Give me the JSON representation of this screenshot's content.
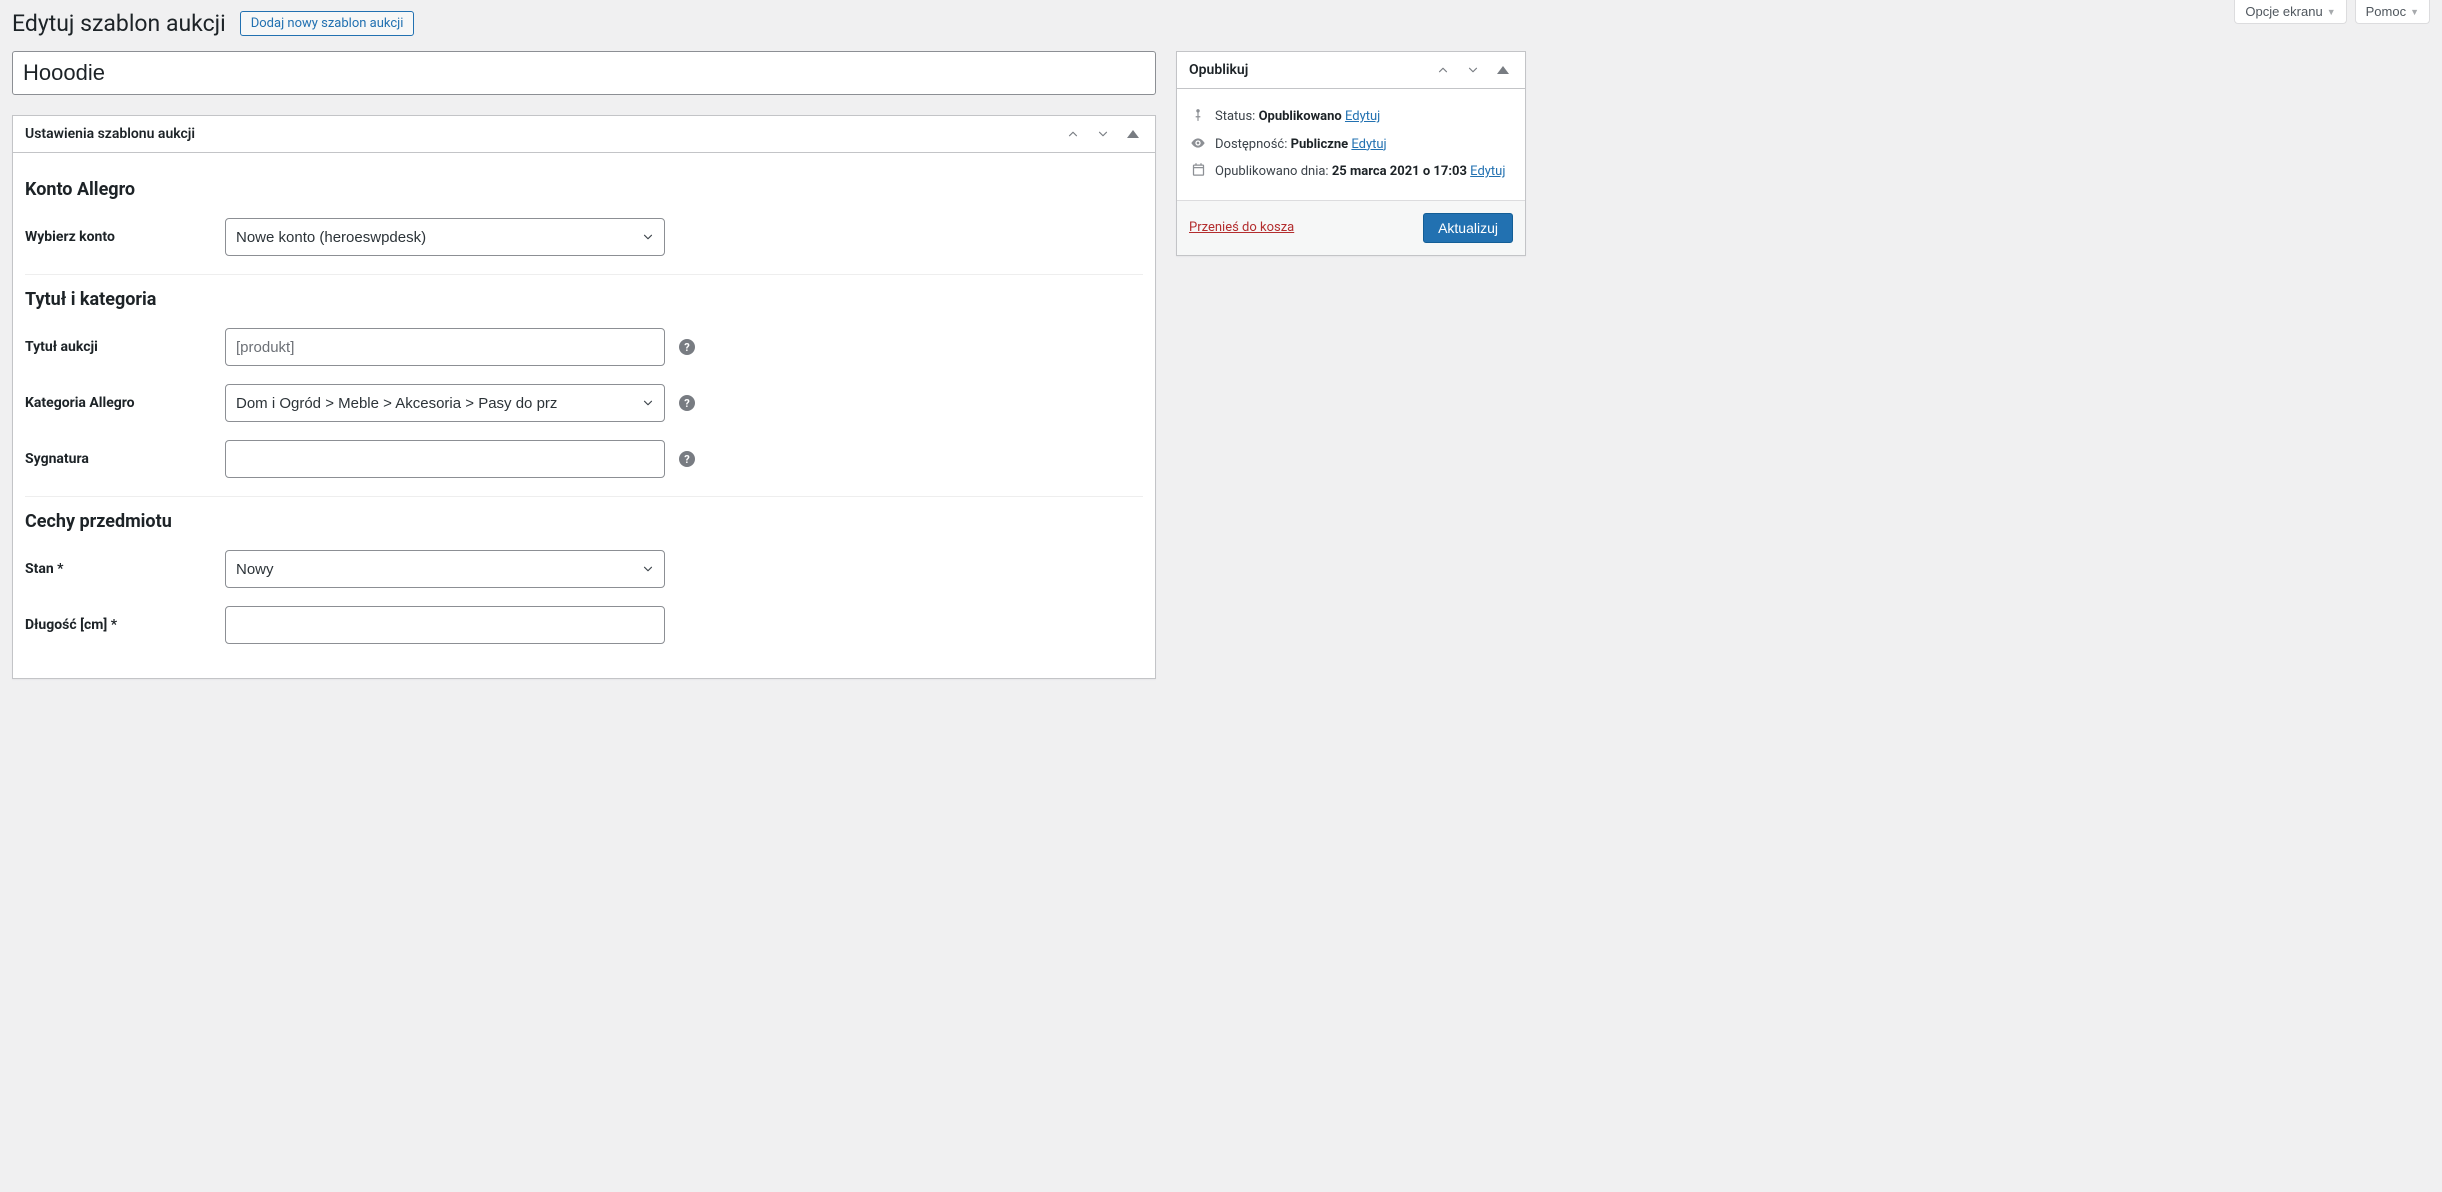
{
  "screen_meta": {
    "screen_options": "Opcje ekranu",
    "help": "Pomoc"
  },
  "header": {
    "page_title": "Edytuj szablon aukcji",
    "add_new": "Dodaj nowy szablon aukcji"
  },
  "title_input": {
    "value": "Hooodie"
  },
  "settings_box": {
    "title": "Ustawienia szablonu aukcji",
    "sections": {
      "account": {
        "heading": "Konto Allegro",
        "select_account_label": "Wybierz konto",
        "select_account_value": "Nowe konto (heroeswpdesk)"
      },
      "title_category": {
        "heading": "Tytuł i kategoria",
        "auction_title_label": "Tytuł aukcji",
        "auction_title_placeholder": "[produkt]",
        "auction_title_value": "",
        "category_label": "Kategoria Allegro",
        "category_value": "Dom i Ogród > Meble > Akcesoria > Pasy do prz",
        "signature_label": "Sygnatura",
        "signature_value": ""
      },
      "features": {
        "heading": "Cechy przedmiotu",
        "condition_label": "Stan *",
        "condition_value": "Nowy",
        "length_label": "Długość [cm] *",
        "length_value": ""
      }
    }
  },
  "publish_box": {
    "title": "Opublikuj",
    "status_label": "Status:",
    "status_value": "Opublikowano",
    "visibility_label": "Dostępność:",
    "visibility_value": "Publiczne",
    "published_label": "Opublikowano dnia:",
    "published_value": "25 marca 2021 o 17:03",
    "edit_link": "Edytuj",
    "trash": "Przenieś do kosza",
    "update": "Aktualizuj"
  }
}
